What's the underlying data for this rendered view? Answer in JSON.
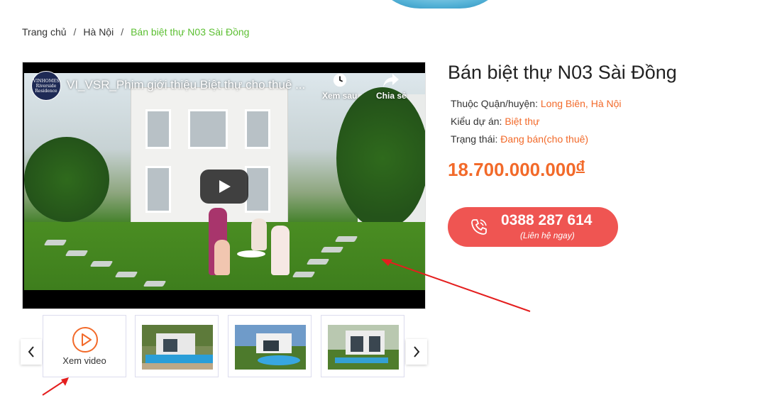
{
  "breadcrumb": {
    "items": [
      "Trang chủ",
      "Hà Nội"
    ],
    "separator": "/",
    "current": "Bán biệt thự N03 Sài Đồng"
  },
  "video": {
    "channel_logo_text": "VINHOMES Riverside Residence",
    "title": "VI_VSR_Phim giới thiệu Biệt thự cho thuê ...",
    "watch_later_label": "Xem sau",
    "share_label": "Chia sẻ"
  },
  "property": {
    "title": "Bán biệt thự N03 Sài Đồng",
    "district_label": "Thuộc Quận/huyện:",
    "district_value": "Long Biên, Hà Nội",
    "type_label": "Kiểu dự án:",
    "type_value": "Biệt thự",
    "status_label": "Trạng thái:",
    "status_value": "Đang bán(cho thuê)",
    "price": "18.700.000.000",
    "currency": "đ"
  },
  "call": {
    "phone": "0388 287 614",
    "subtitle": "(Liên hệ ngay)"
  },
  "gallery": {
    "prev": "‹",
    "next": "›",
    "video_thumb_label": "Xem video"
  },
  "colors": {
    "accent": "#f26a2a",
    "breadcrumb_active": "#5cbf32",
    "call_button": "#ef5552",
    "annotation_arrow": "#e41e1e"
  }
}
